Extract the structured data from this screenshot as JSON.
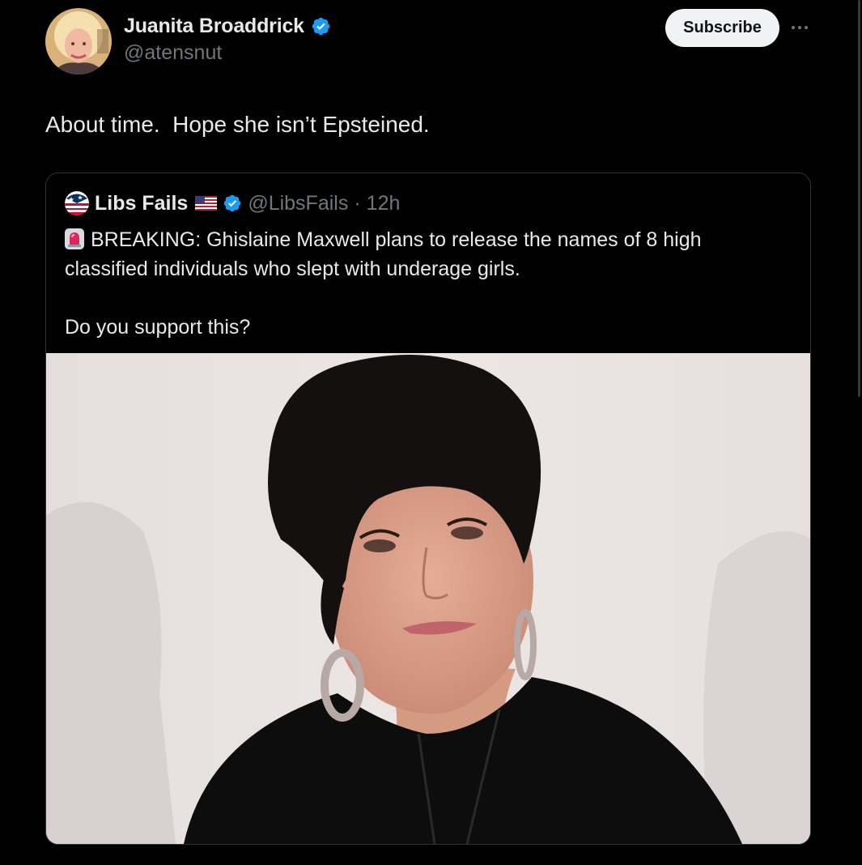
{
  "post": {
    "author_name": "Juanita Broaddrick",
    "author_handle": "@atensnut",
    "subscribe_label": "Subscribe",
    "text": "About time.  Hope she isn’t Epsteined."
  },
  "quote": {
    "author_name": "Libs Fails",
    "author_handle": "@LibsFails",
    "separator": "·",
    "time": "12h",
    "line1": "BREAKING: Ghislaine Maxwell plans to release the names of 8 high",
    "line2": "classified individuals who slept with underage girls.",
    "question": "Do you support this?"
  },
  "icons": {
    "verified": "verified-badge-icon",
    "more": "more-icon",
    "flag": "us-flag-icon",
    "siren": "siren-icon"
  },
  "colors": {
    "background": "#000000",
    "text_primary": "#e7e9ea",
    "text_secondary": "#71767b",
    "verified_blue": "#1d9bf0",
    "button_bg": "#eff3f4"
  }
}
